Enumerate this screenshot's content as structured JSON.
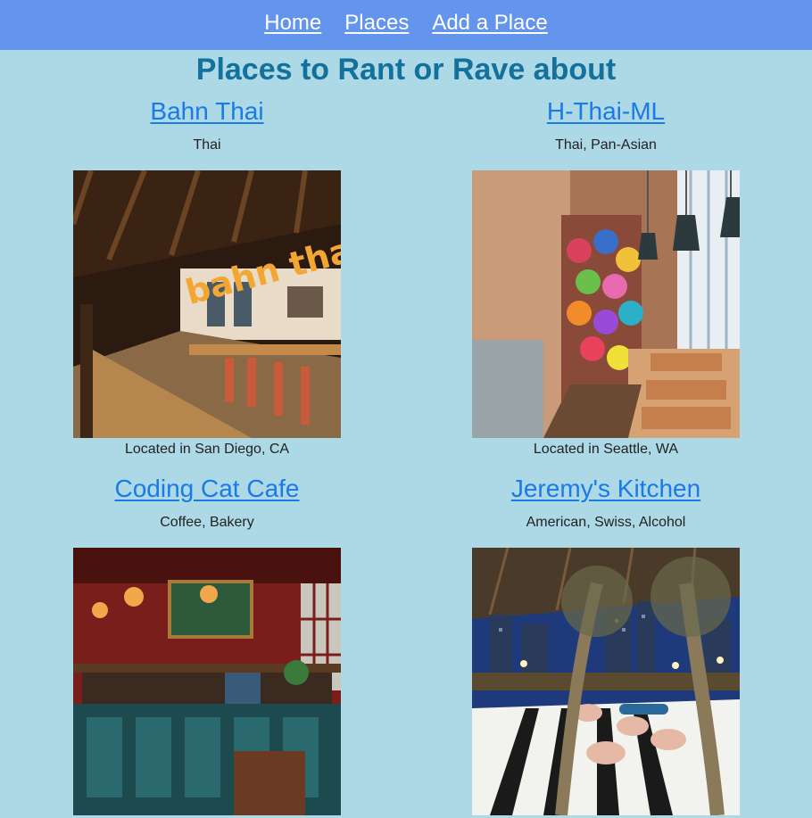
{
  "nav": {
    "home": "Home",
    "places": "Places",
    "add_place": "Add a Place"
  },
  "page": {
    "title": "Places to Rant or Rave about"
  },
  "places": [
    {
      "name": "Bahn Thai",
      "cuisines": "Thai",
      "location": "Located in San Diego, CA",
      "sign_text": "bahn thai"
    },
    {
      "name": "H-Thai-ML",
      "cuisines": "Thai, Pan-Asian",
      "location": "Located in Seattle, WA"
    },
    {
      "name": "Coding Cat Cafe",
      "cuisines": "Coffee, Bakery",
      "location": ""
    },
    {
      "name": "Jeremy's Kitchen",
      "cuisines": "American, Swiss, Alcohol",
      "location": ""
    }
  ],
  "colors": {
    "nav_bg": "#6495ed",
    "page_bg": "#add8e6",
    "title": "#13719c",
    "link": "#1a7ae6"
  }
}
